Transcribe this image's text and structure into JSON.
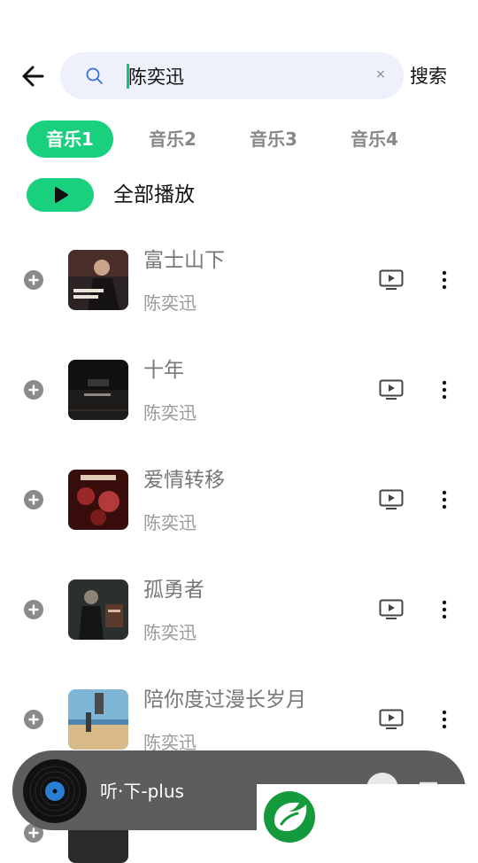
{
  "header": {
    "search_query": "陈奕迅",
    "search_button": "搜索"
  },
  "tabs": [
    "音乐1",
    "音乐2",
    "音乐3",
    "音乐4"
  ],
  "active_tab": 0,
  "play_all_label": "全部播放",
  "songs": [
    {
      "title": "富士山下",
      "artist": "陈奕迅"
    },
    {
      "title": "十年",
      "artist": "陈奕迅"
    },
    {
      "title": "爱情转移",
      "artist": "陈奕迅"
    },
    {
      "title": "孤勇者",
      "artist": "陈奕迅"
    },
    {
      "title": "陪你度过漫长岁月",
      "artist": "陈奕迅"
    }
  ],
  "player": {
    "title": "听·下-plus"
  },
  "colors": {
    "accent": "#19d07f",
    "search_bg": "#eef1fb",
    "player_bg": "#5d5d5d"
  }
}
